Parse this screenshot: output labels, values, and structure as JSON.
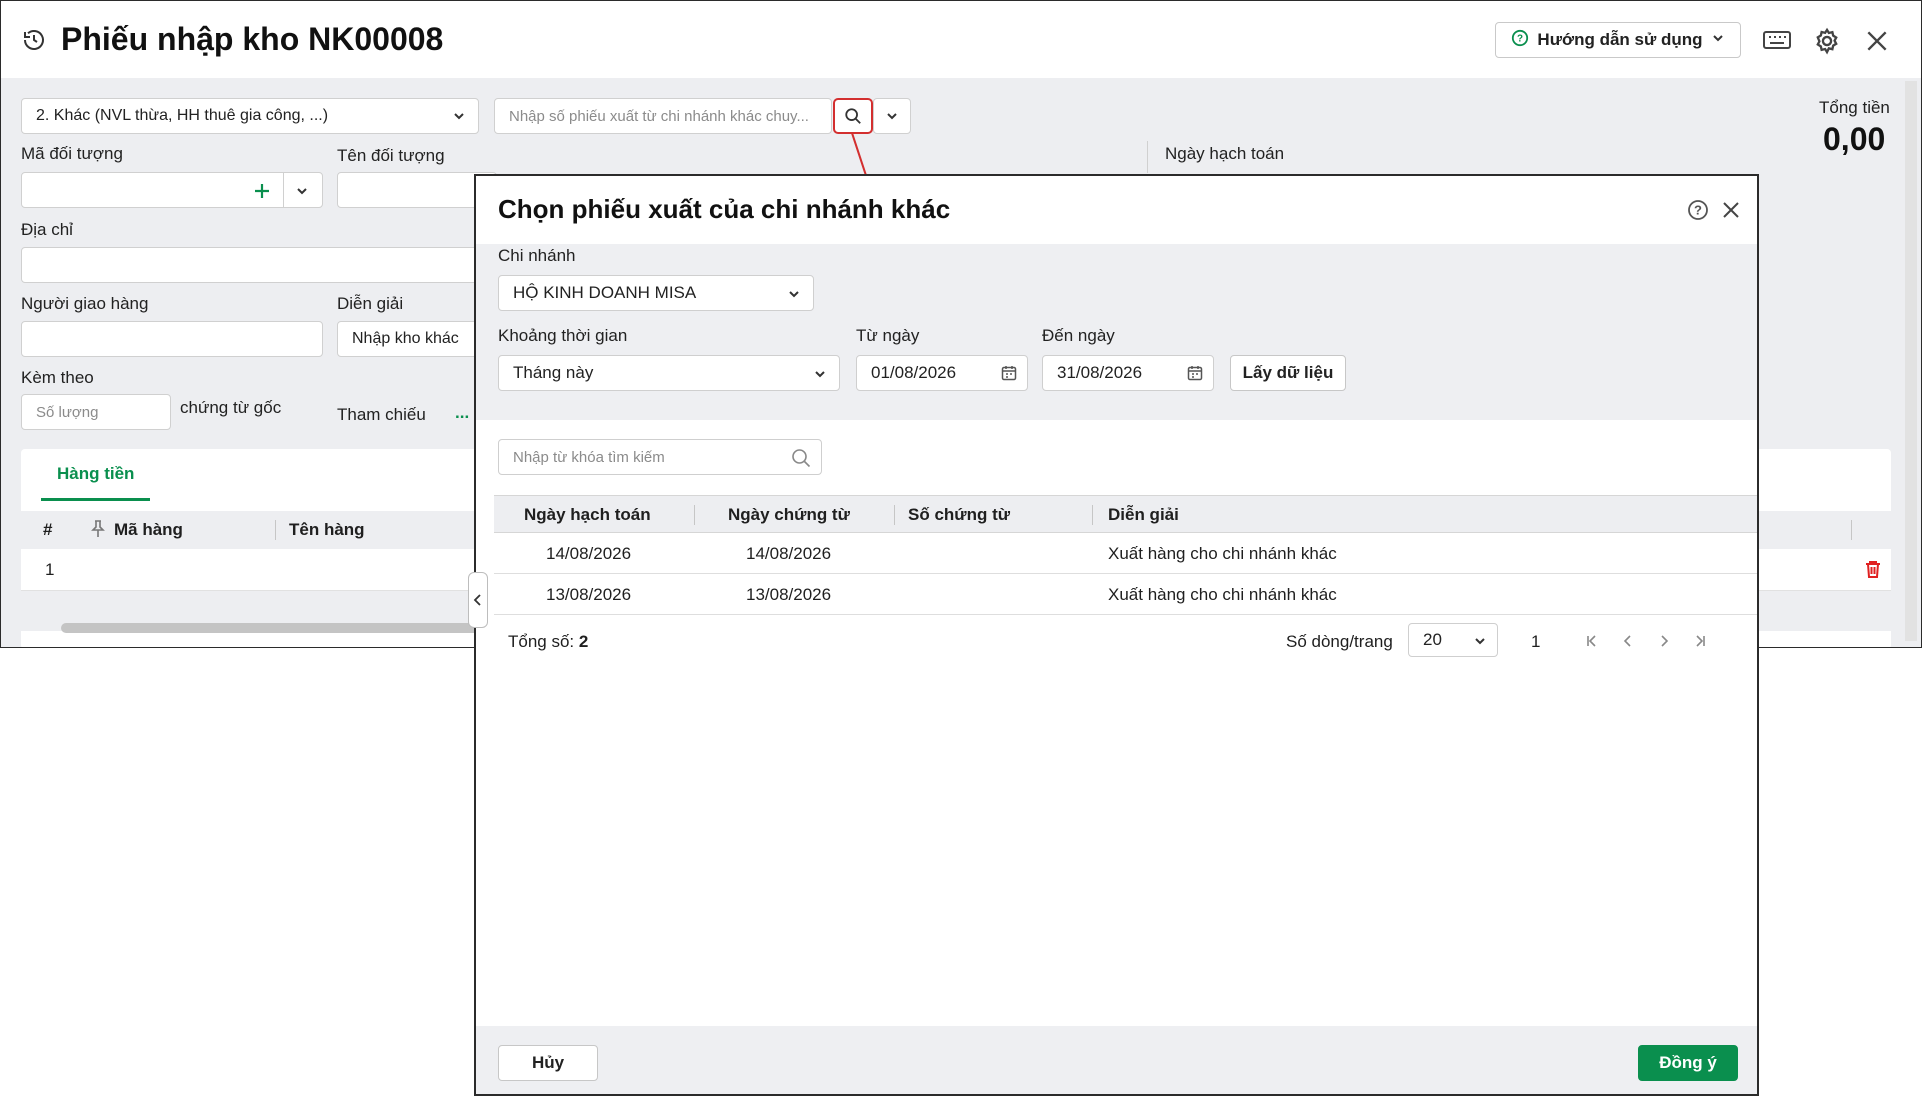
{
  "background": {
    "title": "Phiếu nhập kho NK00008",
    "help_button": "Hướng dẫn sử dụng",
    "import_type": "2. Khác (NVL thừa, HH thuê gia công, ...)",
    "search_placeholder": "Nhập số phiếu xuất từ chi nhánh khác chuy...",
    "total_label": "Tổng tiền",
    "total_value": "0,00",
    "labels": {
      "object_code": "Mã đối tượng",
      "object_name": "Tên đối tượng",
      "accounting_date": "Ngày hạch toán",
      "address": "Địa chỉ",
      "deliverer": "Người giao hàng",
      "description": "Diễn giải",
      "attached": "Kèm theo",
      "original_docs": "chứng từ gốc",
      "reference": "Tham chiếu",
      "reference_more": "..."
    },
    "description_value": "Nhập kho khác",
    "quantity_placeholder": "Số lượng",
    "tab_label": "Hàng tiền",
    "grid": {
      "headers": [
        "#",
        "Mã hàng",
        "Tên hàng"
      ],
      "rows": [
        [
          "1",
          "",
          ""
        ]
      ]
    }
  },
  "modal": {
    "title": "Chọn phiếu xuất của chi nhánh khác",
    "branch_label": "Chi nhánh",
    "branch_value": "HỘ KINH DOANH MISA",
    "period_label": "Khoảng thời gian",
    "period_value": "Tháng này",
    "from_label": "Từ ngày",
    "from_value": "01/08/2026",
    "to_label": "Đến ngày",
    "to_value": "31/08/2026",
    "fetch_button": "Lấy dữ liệu",
    "search_placeholder": "Nhập từ khóa tìm kiếm",
    "table": {
      "headers": [
        "Ngày hạch toán",
        "Ngày chứng từ",
        "Số chứng từ",
        "Diễn giải"
      ],
      "rows": [
        [
          "14/08/2026",
          "14/08/2026",
          "",
          "Xuất hàng cho chi nhánh khác"
        ],
        [
          "13/08/2026",
          "13/08/2026",
          "",
          "Xuất hàng cho chi nhánh khác"
        ]
      ]
    },
    "total_label": "Tổng số:",
    "total_count": "2",
    "rows_per_page_label": "Số dòng/trang",
    "rows_per_page_value": "20",
    "current_page": "1",
    "cancel_button": "Hủy",
    "ok_button": "Đồng ý"
  },
  "colors": {
    "accent_green": "#0a8f4e",
    "delete_red": "#e02020",
    "highlight_red": "#d32f2f"
  }
}
